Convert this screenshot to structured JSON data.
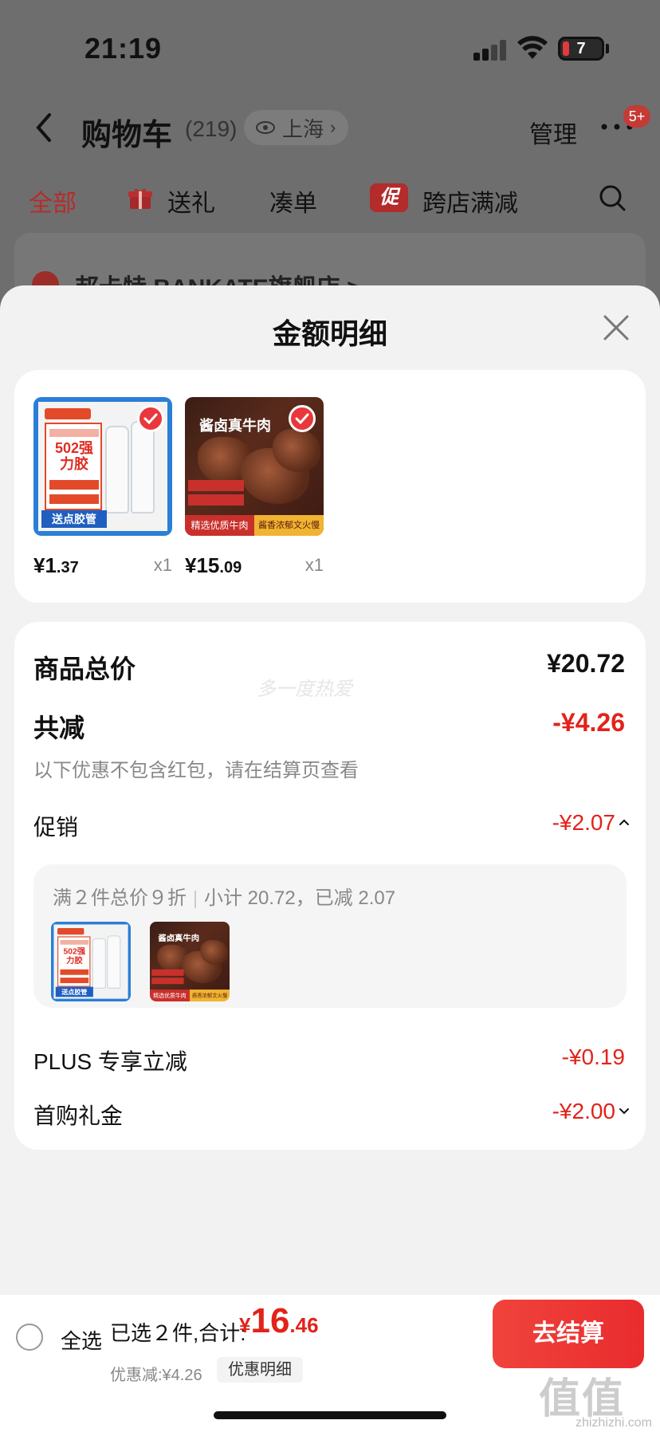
{
  "status_bar": {
    "time": "21:19",
    "battery": "7"
  },
  "nav": {
    "title": "购物车",
    "count": "(219)",
    "location": "上海",
    "manage": "管理",
    "more_badge": "5+"
  },
  "filter_tabs": [
    {
      "label": "全部",
      "active": true
    },
    {
      "label": "送礼"
    },
    {
      "label": "凑单"
    },
    {
      "label": "跨店满减",
      "badge": "促"
    }
  ],
  "store": {
    "name": "邦卡特 BANKATE旗舰店 >"
  },
  "sheet": {
    "title": "金额明细",
    "products": [
      {
        "name": "502强力胶",
        "thumb_text": {
          "brand": "邦卡特",
          "title": "502强力胶",
          "tag": "送点胶管"
        },
        "price_main": "¥1",
        "price_dec": ".37",
        "qty": "x1",
        "checked": true
      },
      {
        "name": "酱卤真牛肉",
        "thumb_text": {
          "title": "酱卤真牛肉",
          "left": "精选优质牛肉",
          "right": "酱香浓郁文火慢炖"
        },
        "price_main": "¥15",
        "price_dec": ".09",
        "qty": "x1",
        "checked": true
      }
    ],
    "summary": {
      "goods_total_label": "商品总价",
      "goods_total_value": "¥20.72",
      "watermark": "多一度热爱",
      "total_reduce_label": "共减",
      "total_reduce_value": "-¥4.26",
      "reduce_note": "以下优惠不包含红包，请在结算页查看",
      "promo_label": "促销",
      "promo_value": "-¥2.07",
      "promo_detail_left": "满２件总价９折",
      "promo_detail_right": "小计 20.72，已减 2.07",
      "plus_label": "PLUS 专享立减",
      "plus_value": "-¥0.19",
      "first_gift_label": "首购礼金",
      "first_gift_value": "-¥2.00"
    }
  },
  "bottom": {
    "select_all": "全选",
    "selected_prefix": "已选２件,合计:",
    "total_cur": "¥",
    "total_int": "16",
    "total_dec": ".46",
    "discount_line": "优惠减:¥4.26",
    "discount_detail_btn": "优惠明细",
    "checkout": "去结算"
  },
  "watermark_logo": {
    "big": "值值值",
    "small": "zhizhizhi.com"
  },
  "colors": {
    "accent_red": "#e2231a",
    "checkout_red": "#ef3a36"
  }
}
